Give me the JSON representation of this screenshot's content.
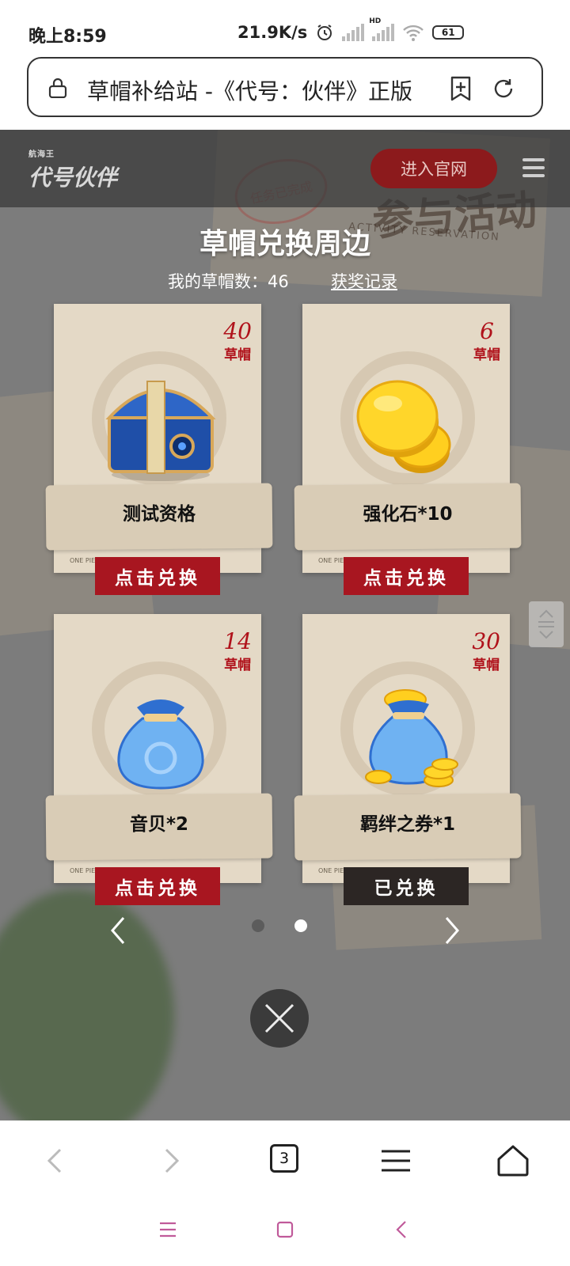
{
  "status_bar": {
    "time": "晚上8:59",
    "net_speed": "21.9K/s",
    "wifi_badge": "HD",
    "battery": "61",
    "icons": [
      "alarm-icon",
      "signal-icon",
      "signal-hd-icon",
      "wifi-icon",
      "battery-icon"
    ]
  },
  "browser": {
    "page_title": "草帽补给站 -《代号：伙伴》正版",
    "tab_count": "3"
  },
  "site": {
    "logo_small": "航海王",
    "logo": "代号伙伴",
    "enter_button": "进入官网",
    "bg_activity": "参与活动",
    "bg_activity_en": "ACTIVITY RESERVATION",
    "bg_stamp": "任务已完成"
  },
  "modal": {
    "title": "草帽兑换周边",
    "hat_count_label": "我的草帽数：",
    "hat_count": "46",
    "record_link": "获奖记录",
    "cards": [
      {
        "cost": "40",
        "unit": "草帽",
        "name": "测试资格",
        "button": "点击兑换",
        "redeemed": false,
        "art": "treasure-chest"
      },
      {
        "cost": "6",
        "unit": "草帽",
        "name": "强化石*10",
        "button": "点击兑换",
        "redeemed": false,
        "art": "gold-coins"
      },
      {
        "cost": "14",
        "unit": "草帽",
        "name": "音贝*2",
        "button": "点击兑换",
        "redeemed": false,
        "art": "blue-bag"
      },
      {
        "cost": "30",
        "unit": "草帽",
        "name": "羁绊之券*1",
        "button": "已兑换",
        "redeemed": true,
        "art": "coin-bag"
      }
    ],
    "card_tag": "ONE PIECE",
    "pagination": {
      "pages": 2,
      "current": 2
    }
  },
  "colors": {
    "accent_red": "#a81620",
    "redeemed_dark": "#2c2624",
    "cost_red": "#b0121b"
  }
}
